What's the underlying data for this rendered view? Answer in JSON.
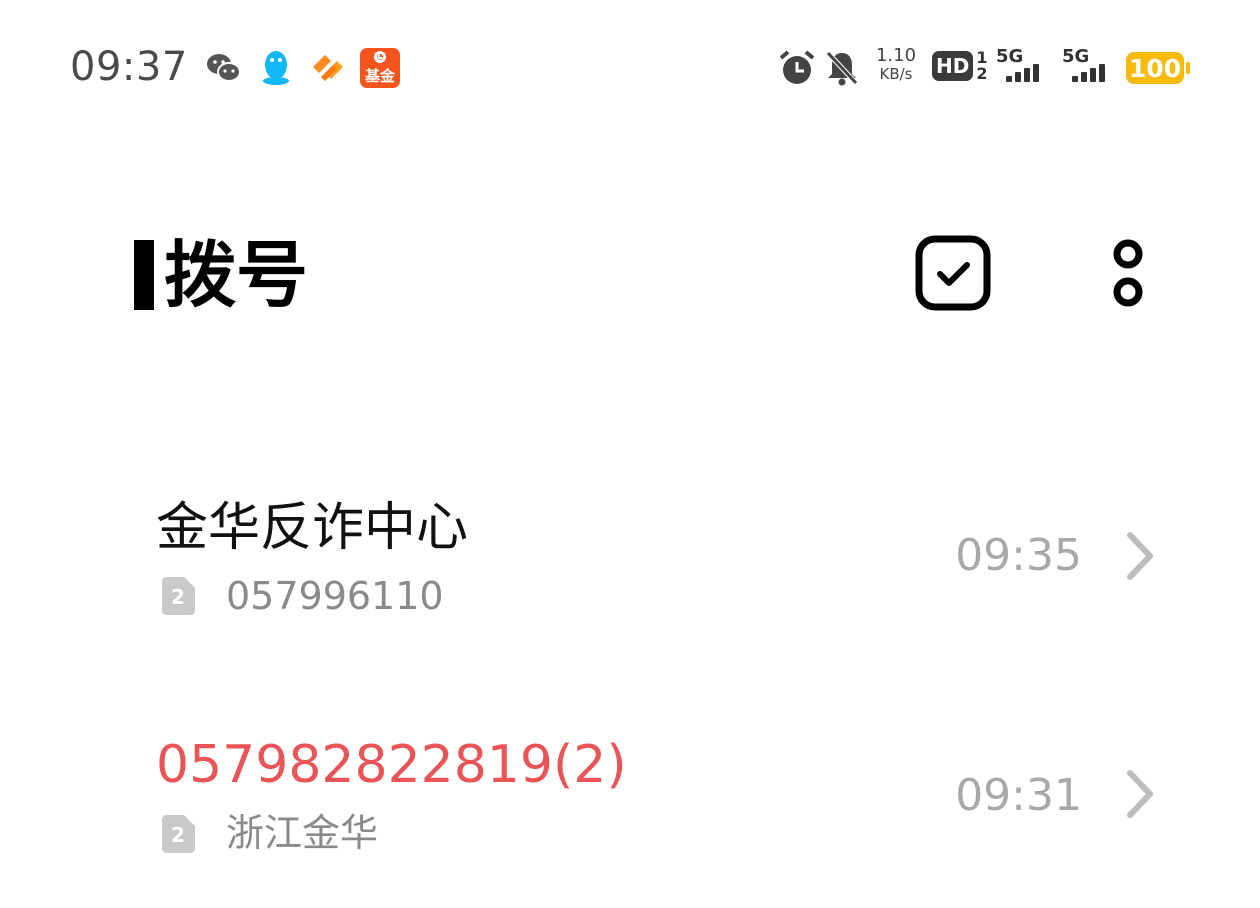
{
  "status_bar": {
    "time": "09:37",
    "notification_icons": [
      "wechat-icon",
      "qq-icon",
      "heart-app-icon",
      "fund-app-icon"
    ],
    "fund_app_label": "基金",
    "net_speed_value": "1.10",
    "net_speed_unit": "KB/s",
    "hd_label": "HD",
    "hd_sim_top": "1",
    "hd_sim_bottom": "2",
    "signal_1_label": "5G",
    "signal_2_label": "5G",
    "battery_level": "100",
    "battery_color": "#f5bc0e"
  },
  "header": {
    "title": "拨号"
  },
  "calls": [
    {
      "name": "金华反诈中心",
      "sim": "2",
      "subtitle": "057996110",
      "time": "09:35",
      "missed": false
    },
    {
      "name": "057982822819(2)",
      "sim": "2",
      "subtitle": "浙江金华",
      "time": "09:31",
      "missed": true
    }
  ],
  "colors": {
    "missed": "#e95556",
    "secondary_text": "#8a8a8a",
    "time_text": "#a8a8a8"
  }
}
